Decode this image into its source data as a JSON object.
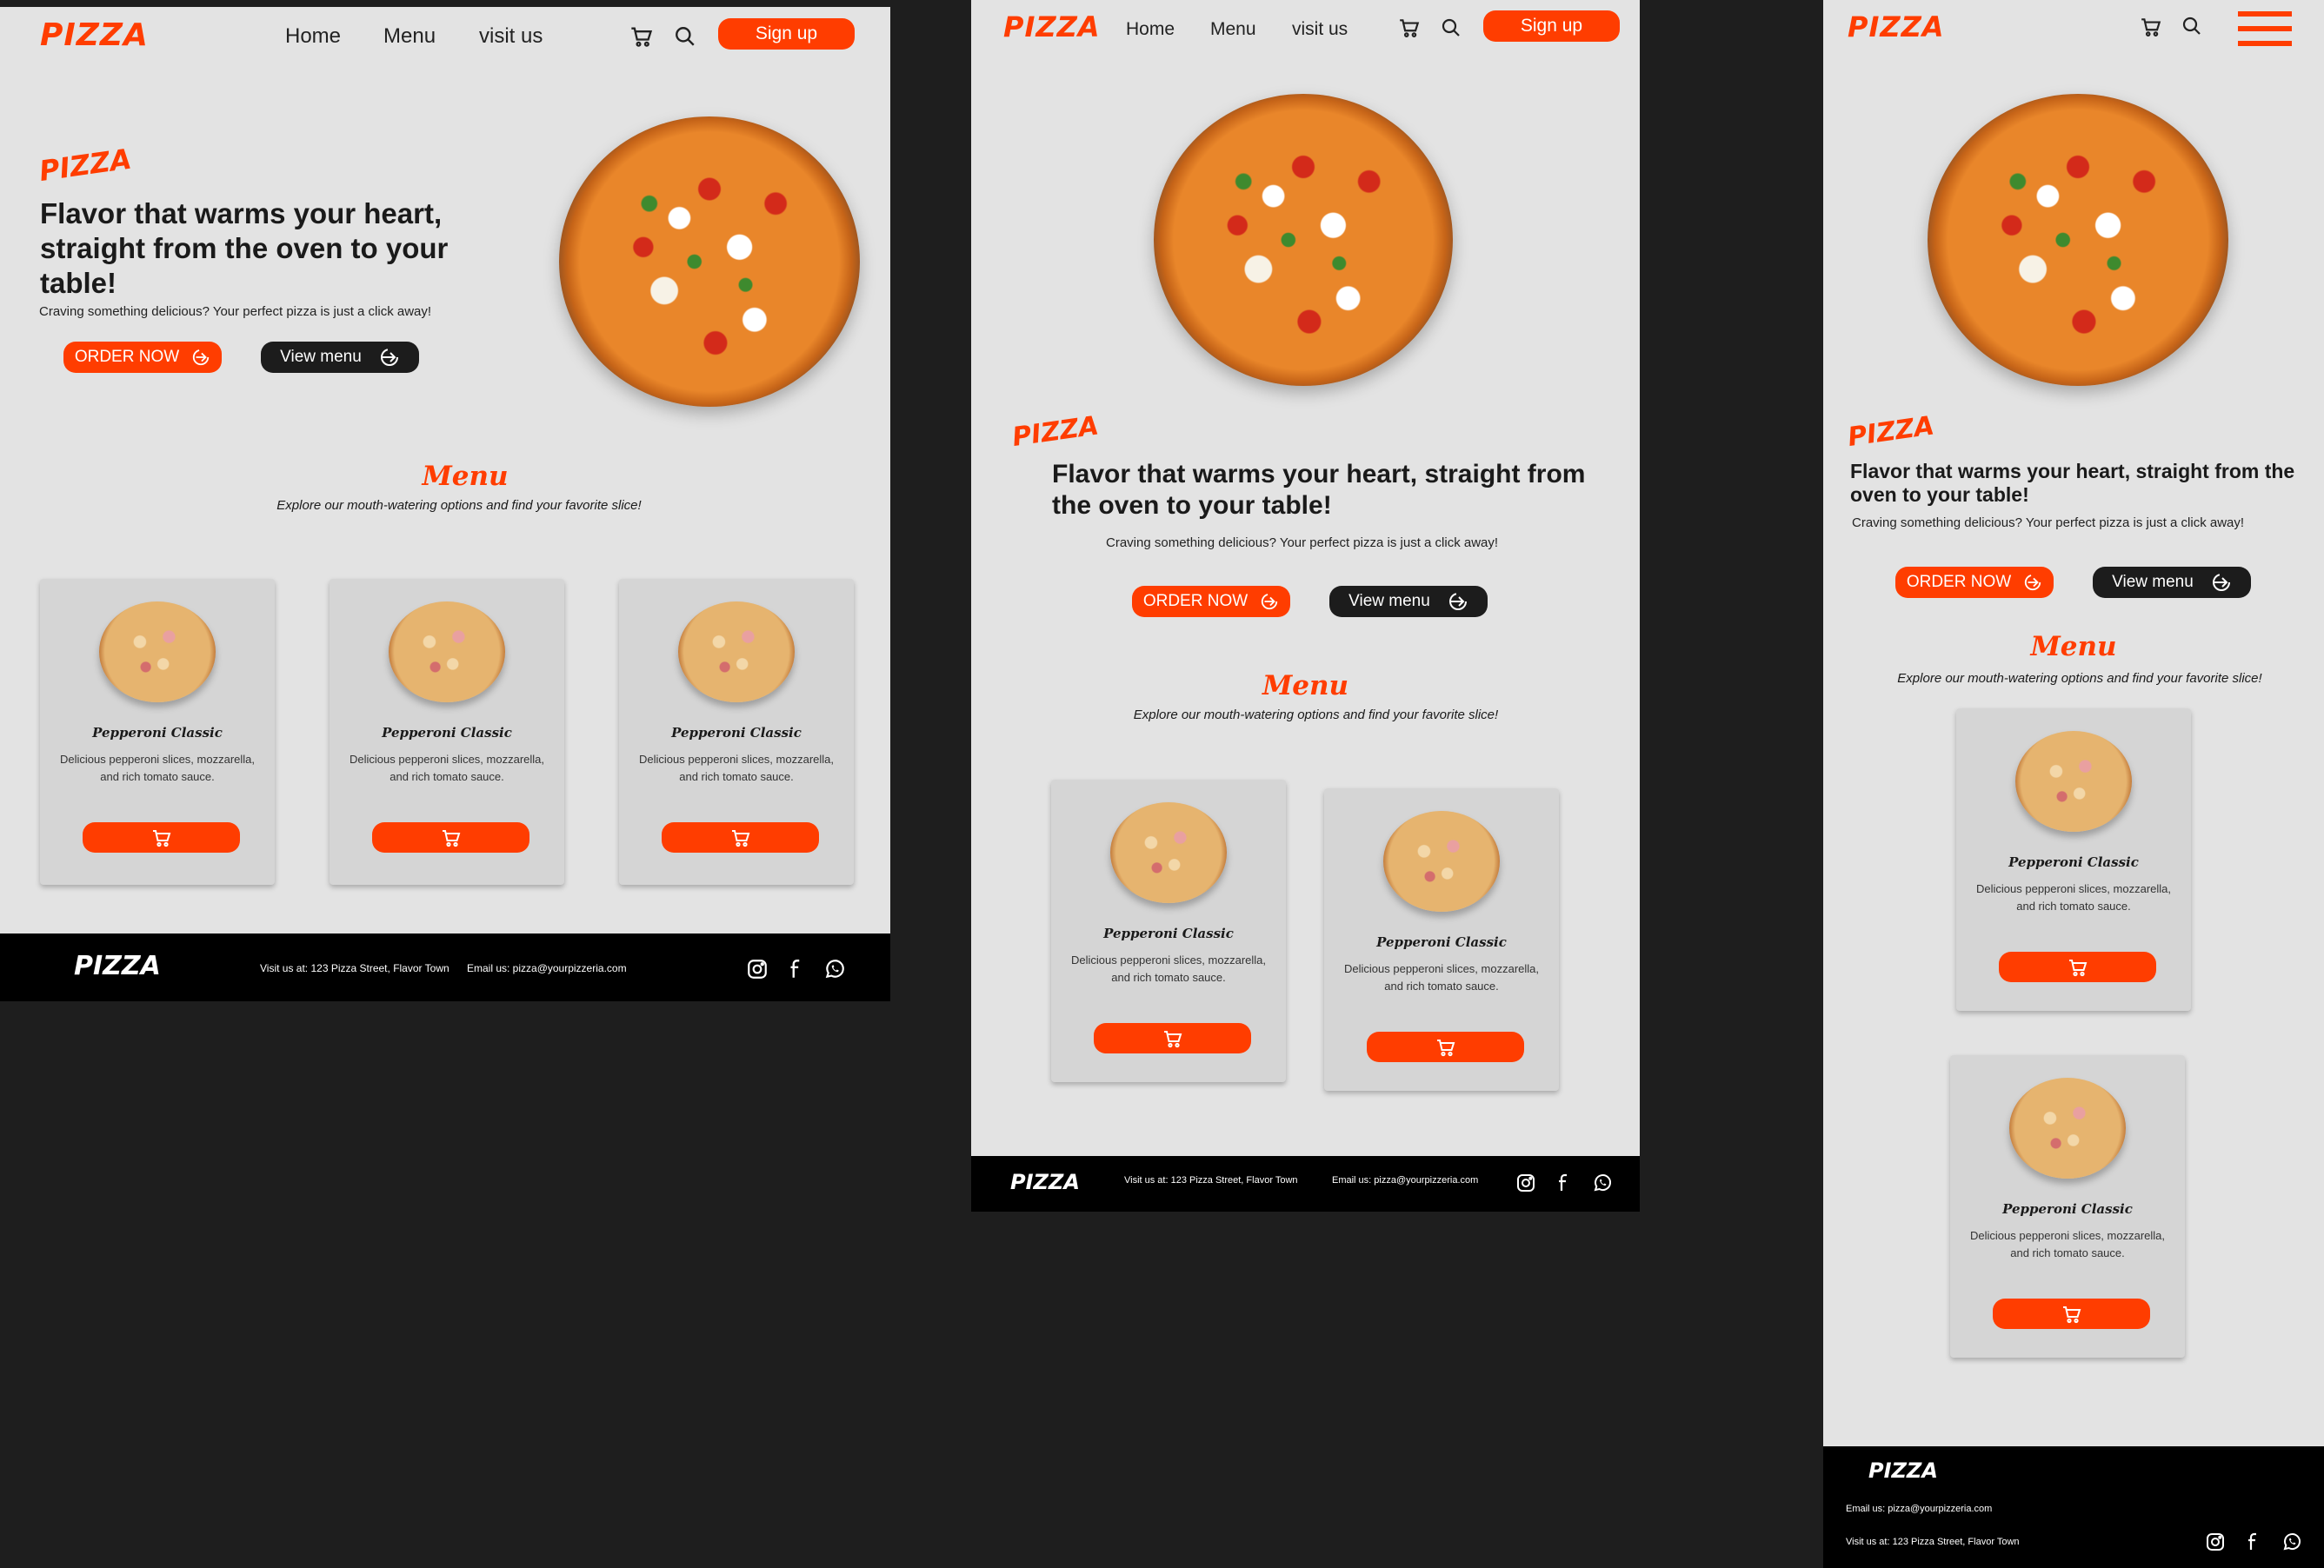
{
  "brand": {
    "logo": "PIZZA",
    "accent_color": "#ff3d00",
    "dark_color": "#1c1c1c",
    "bg_color": "#e3e3e3"
  },
  "nav": {
    "home": "Home",
    "menu": "Menu",
    "visit": "visit us",
    "signup": "Sign up"
  },
  "hero": {
    "tag": "PIZZA",
    "title": "Flavor that warms your heart, straight from the oven to your table!",
    "subtitle": "Craving something delicious? Your perfect pizza is just a click away!",
    "order_label": "ORDER NOW",
    "view_label": "View menu"
  },
  "menu": {
    "title": "Menu",
    "subtitle": "Explore our mouth-watering options and find your favorite slice!",
    "items": [
      {
        "name": "Pepperoni Classic",
        "desc": "Delicious pepperoni slices, mozzarella, and rich tomato sauce."
      },
      {
        "name": "Pepperoni Classic",
        "desc": "Delicious pepperoni slices, mozzarella, and rich tomato sauce."
      },
      {
        "name": "Pepperoni Classic",
        "desc": "Delicious pepperoni slices, mozzarella, and rich tomato sauce."
      }
    ]
  },
  "footer": {
    "logo": "PIZZA",
    "address": "Visit us at: 123 Pizza Street, Flavor Town",
    "email": "Email us: pizza@yourpizzeria.com"
  },
  "icons": [
    "cart-icon",
    "search-icon",
    "hamburger-icon",
    "arrow-right-icon",
    "instagram-icon",
    "facebook-icon",
    "whatsapp-icon"
  ]
}
